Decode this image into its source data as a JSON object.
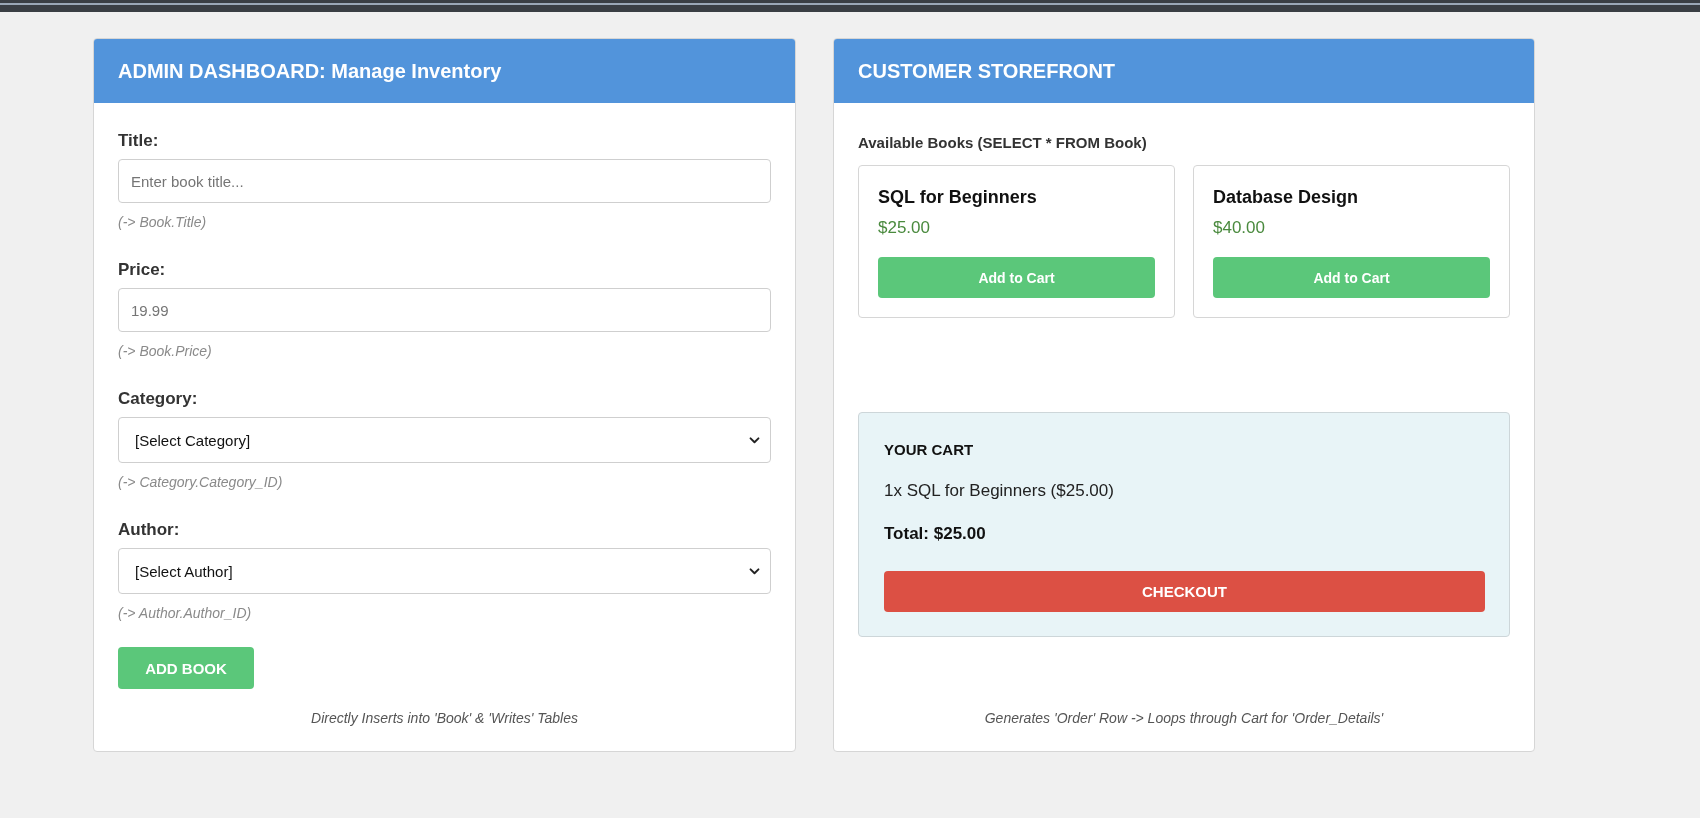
{
  "admin_panel": {
    "title": "ADMIN DASHBOARD: Manage Inventory",
    "fields": [
      {
        "kind": "text",
        "label": "Title:",
        "placeholder": "Enter book title...",
        "hint": "(-> Book.Title)"
      },
      {
        "kind": "text",
        "label": "Price:",
        "placeholder": "19.99",
        "hint": "(-> Book.Price)"
      },
      {
        "kind": "select",
        "label": "Category:",
        "value": "[Select Category]",
        "hint": "(-> Category.Category_ID)"
      },
      {
        "kind": "select",
        "label": "Author:",
        "value": "[Select Author]",
        "hint": "(-> Author.Author_ID)"
      }
    ],
    "button": "ADD BOOK",
    "note": "Directly Inserts into 'Book' & 'Writes' Tables"
  },
  "storefront": {
    "title": "CUSTOMER STOREFRONT",
    "section_label": "Available Books (SELECT * FROM Book)",
    "books": [
      {
        "title": "SQL for Beginners",
        "price": "$25.00",
        "button": "Add to Cart"
      },
      {
        "title": "Database Design",
        "price": "$40.00",
        "button": "Add to Cart"
      }
    ],
    "cart": {
      "title": "YOUR CART",
      "items": [
        "1x SQL for Beginners ($25.00)"
      ],
      "total": "Total: $25.00",
      "button": "CHECKOUT"
    },
    "note": "Generates 'Order' Row -> Loops through Cart for 'Order_Details'"
  }
}
